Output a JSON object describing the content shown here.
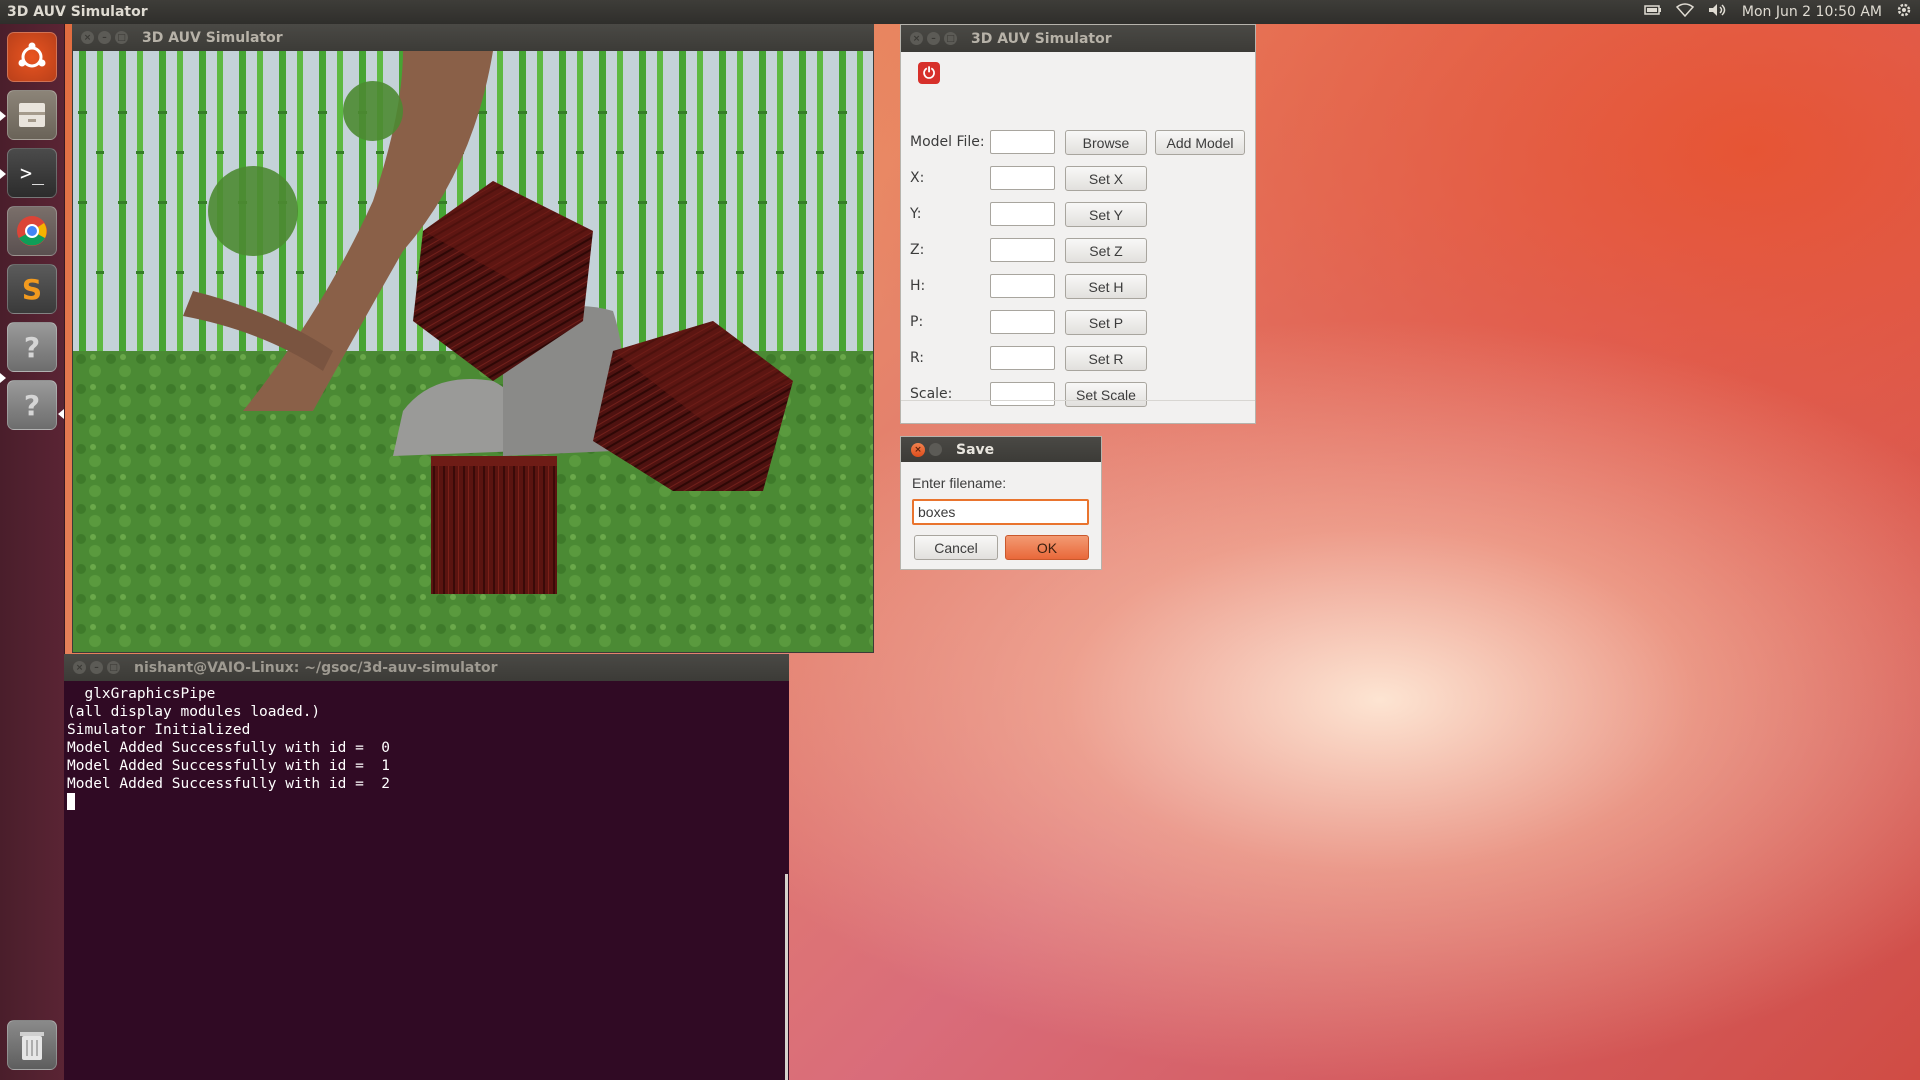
{
  "top_panel": {
    "app_title": "3D AUV Simulator",
    "clock": "Mon Jun 2  10:50 AM",
    "indicators": [
      "battery-icon",
      "wifi-icon",
      "volume-icon",
      "settings-gear-icon"
    ]
  },
  "launcher": {
    "items": [
      "ubuntu-dash-icon",
      "files-icon",
      "terminal-icon",
      "chrome-icon",
      "sublime-text-icon",
      "unknown-app-icon",
      "unknown-app-icon",
      "trash-icon"
    ],
    "term_glyph": ">_",
    "sublime_glyph": "S",
    "unknown_glyph": "?"
  },
  "sim_window": {
    "title": "3D AUV Simulator"
  },
  "control_window": {
    "title": "3D AUV Simulator",
    "model_file_label": "Model File:",
    "model_file_value": "",
    "browse_label": "Browse",
    "add_model_label": "Add Model",
    "rows": [
      {
        "label": "X:",
        "value": "",
        "button": "Set X"
      },
      {
        "label": "Y:",
        "value": "",
        "button": "Set Y"
      },
      {
        "label": "Z:",
        "value": "",
        "button": "Set Z"
      },
      {
        "label": "H:",
        "value": "",
        "button": "Set H"
      },
      {
        "label": "P:",
        "value": "",
        "button": "Set P"
      },
      {
        "label": "R:",
        "value": "",
        "button": "Set R"
      },
      {
        "label": "Scale:",
        "value": "",
        "button": "Set Scale"
      }
    ]
  },
  "save_dialog": {
    "title": "Save",
    "prompt": "Enter filename:",
    "filename": "boxes",
    "cancel_label": "Cancel",
    "ok_label": "OK"
  },
  "terminal": {
    "title": "nishant@VAIO-Linux: ~/gsoc/3d-auv-simulator",
    "lines": [
      "  glxGraphicsPipe",
      "(all display modules loaded.)",
      "Simulator Initialized",
      "Model Added Successfully with id =  0",
      "Model Added Successfully with id =  1",
      "Model Added Successfully with id =  2"
    ]
  },
  "colors": {
    "accent": "#e95420",
    "terminal_bg": "#300a24",
    "launcher_bg": "#4a1e2b"
  }
}
